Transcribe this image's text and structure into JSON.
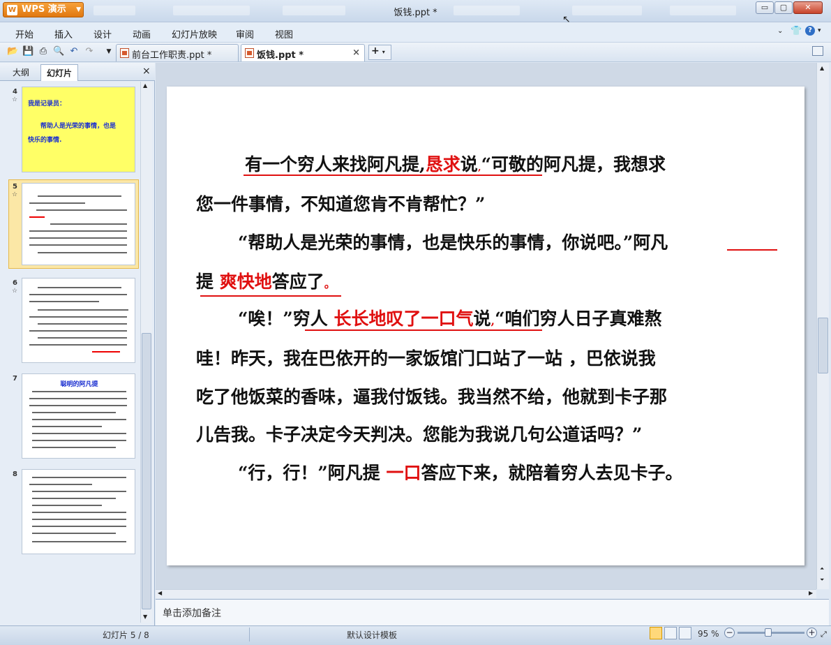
{
  "app": {
    "name": "WPS 演示",
    "window_title": "饭钱.ppt *"
  },
  "window_controls": {
    "minimize": "▭",
    "maximize": "▢",
    "close": "✕"
  },
  "menu": {
    "items": [
      "开始",
      "插入",
      "设计",
      "动画",
      "幻灯片放映",
      "审阅",
      "视图"
    ]
  },
  "tabs": [
    {
      "label": "前台工作职责.ppt *",
      "close": "×"
    },
    {
      "label": "饭钱.ppt *",
      "close": "×"
    }
  ],
  "tab_add": "+",
  "left_pane": {
    "tabs": {
      "outline": "大纲",
      "slides": "幻灯片",
      "close": "×"
    },
    "slides": [
      {
        "number": "4",
        "star": "☆",
        "line1": "我是记录员：",
        "line2": "帮助人是光荣的事情，也是",
        "line3": "快乐的事情."
      },
      {
        "number": "5",
        "star": "☆"
      },
      {
        "number": "6",
        "star": "☆"
      },
      {
        "number": "7",
        "title": "聪明的阿凡提"
      },
      {
        "number": "8"
      }
    ]
  },
  "slide": {
    "l1a": "有一个穷人来找阿凡提,",
    "l1r": "恳求",
    "l1b": "说",
    "l1c": "“可敬的阿凡提，我想求",
    "l2": "您一件事情，不知道您肯不肯帮忙？”",
    "l3a": "“帮助人是光荣的事情，也是快乐的事情，你说吧。”阿凡",
    "l4a": "提",
    "l4r": "爽快地",
    "l4b": "答应了",
    "l5a": "“唉！”穷人",
    "l5r": "长长地叹了一口气",
    "l5b": "说",
    "l5c": "“咱们穷人日子真难熬",
    "l6": "哇！昨天，我在巴依开的一家饭馆门口站了一站 ，巴依说我",
    "l7": "吃了他饭菜的香味，逼我付饭钱。我当然不给，他就到卡子那",
    "l8": "儿告我。卡子决定今天判决。您能为我说几句公道话吗？”",
    "l9a": "“行，行！”阿凡提",
    "l9r": "一口",
    "l9b": "答应下来，就陪着穷人去见卡子。"
  },
  "notes": {
    "placeholder": "单击添加备注"
  },
  "status": {
    "slide_counter": "幻灯片 5 / 8",
    "template": "默认设计模板",
    "zoom": "95 %",
    "zoom_level_percent": 95
  },
  "colors": {
    "accent": "#e01010",
    "wps_orange": "#e07810",
    "thumb_yellow": "#ffff66"
  }
}
